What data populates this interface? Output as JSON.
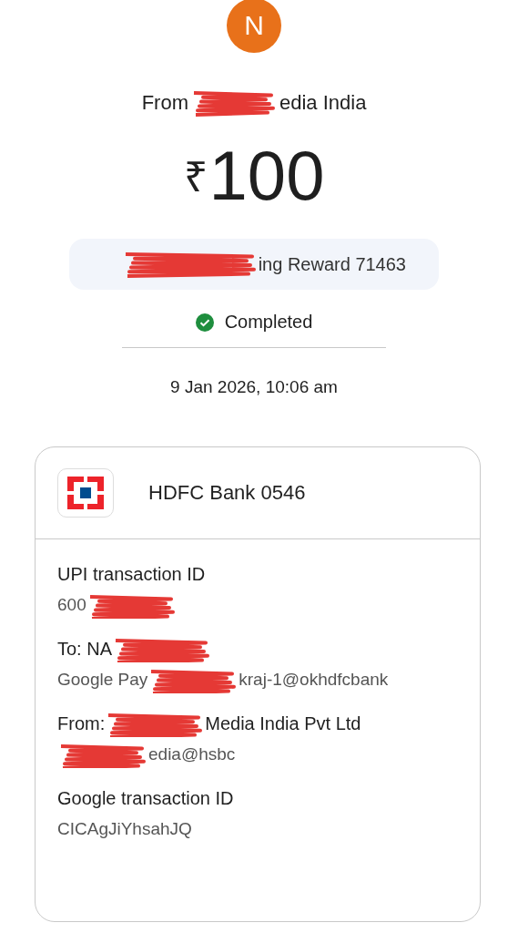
{
  "avatar": {
    "letter": "N",
    "color": "#e8711a"
  },
  "sender": [
    {
      "kind": "text",
      "text": "From"
    },
    {
      "kind": "redacted"
    },
    {
      "kind": "text",
      "text": "edia India"
    }
  ],
  "amount": {
    "currency": "₹",
    "value": "100"
  },
  "note": [
    {
      "kind": "redacted"
    },
    {
      "kind": "text",
      "text": "ing Reward 71463"
    }
  ],
  "status": {
    "label": "Completed",
    "kind": "completed"
  },
  "date": "9 Jan 2026, 10:06 am",
  "account": {
    "name": "HDFC Bank 0546"
  },
  "details": [
    {
      "title": [
        {
          "kind": "text",
          "text": "UPI transaction ID"
        }
      ],
      "value": [
        {
          "kind": "text",
          "text": "600"
        },
        {
          "kind": "redacted"
        }
      ]
    },
    {
      "title": [
        {
          "kind": "text",
          "text": "To: NA"
        },
        {
          "kind": "redacted"
        }
      ],
      "value": [
        {
          "kind": "text",
          "text": "Google Pay"
        },
        {
          "kind": "redacted"
        },
        {
          "kind": "text",
          "text": "kraj-1@okhdfcbank"
        }
      ]
    },
    {
      "title": [
        {
          "kind": "text",
          "text": "From:"
        },
        {
          "kind": "redacted"
        },
        {
          "kind": "text",
          "text": "Media India Pvt Ltd"
        }
      ],
      "value": [
        {
          "kind": "redacted"
        },
        {
          "kind": "text",
          "text": "edia@hsbc"
        }
      ]
    },
    {
      "title": [
        {
          "kind": "text",
          "text": "Google transaction ID"
        }
      ],
      "value": [
        {
          "kind": "text",
          "text": "CICAgJiYhsahJQ"
        }
      ]
    }
  ]
}
